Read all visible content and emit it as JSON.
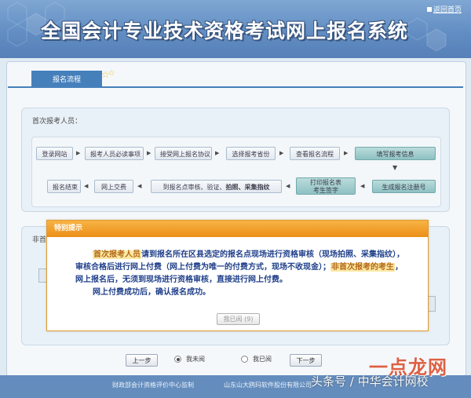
{
  "header": {
    "title": "全国会计专业技术资格考试网上报名系统",
    "home_link": "返回首页"
  },
  "tab": {
    "label": "报名流程"
  },
  "section1": {
    "title": "首次报考人员：",
    "row1": [
      "登录网站",
      "报考人员必读事项",
      "接受网上报名协议",
      "选择报考省份",
      "查看报名流程",
      "填写报考信息"
    ],
    "row2": {
      "end": "报名结束",
      "pay": "网上交费",
      "verify_prefix": "到报名点审核、验证、",
      "verify_bold": "拍照、采集指纹",
      "print_line1": "打印报名表",
      "print_line2": "考生签字",
      "generate": "生成报名注册号"
    }
  },
  "section2": {
    "title": "非首"
  },
  "modal": {
    "title": "特别提示",
    "highlight_first": "首次报考人员",
    "text_first": "请到报名所在区县选定的报名点现场进行资格审核（现场拍照、采集指纹），审核合格后进行网上付费（网上付费为唯一的付费方式，现场不收现金）；",
    "highlight_nonfirst": "非首次报考的考生",
    "text_nonfirst": "，网上报名后，无须到现场进行资格审核，直接进行网上付费。",
    "text_success": "网上付费成功后，确认报名成功。",
    "button": "我已阅 (9)"
  },
  "nav": {
    "prev": "上一步",
    "radio_unread": "我未阅",
    "radio_read": "我已阅",
    "next": "下一步"
  },
  "footer": {
    "left": "财政部会计资格评价中心监制",
    "right": "山东山大鸥玛软件股份有限公司"
  },
  "watermark": {
    "text": "头条号 / 中华会计网校",
    "badge": "一点龙网"
  },
  "colors": {
    "header_blue": "#4d7fbc",
    "tab_blue": "#2c6fb2",
    "modal_orange": "#eb8f16",
    "teal_step": "#7fb9bb",
    "highlight_bg": "#fbe8a4"
  }
}
